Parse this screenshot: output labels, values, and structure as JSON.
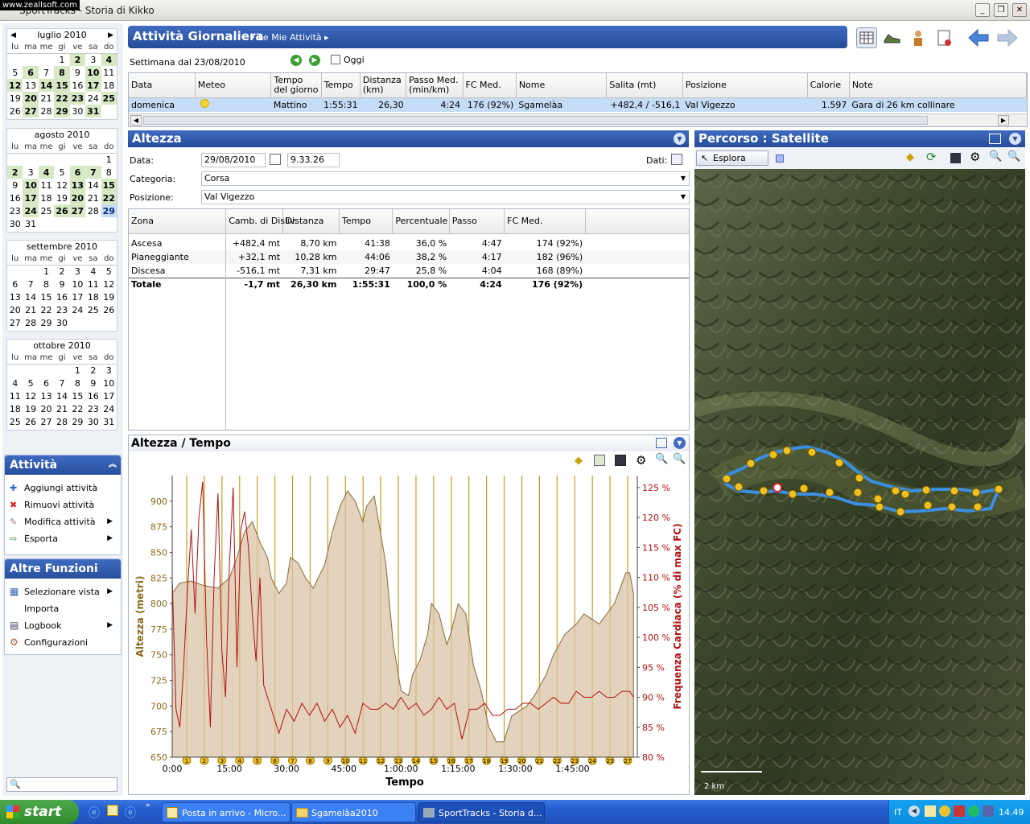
{
  "watermark": "www.zeallsoft.com",
  "window_title": "SportTracks - Storia di Kikko",
  "calendars": [
    {
      "month": "luglio 2010",
      "days": [
        "lu",
        "ma",
        "me",
        "gi",
        "ve",
        "sa",
        "do"
      ],
      "weeks": [
        [
          "",
          "",
          "",
          "1",
          "2",
          "3",
          "4"
        ],
        [
          "5",
          "6",
          "7",
          "8",
          "9",
          "10",
          "11"
        ],
        [
          "12",
          "13",
          "14",
          "15",
          "16",
          "17",
          "18"
        ],
        [
          "19",
          "20",
          "21",
          "22",
          "23",
          "24",
          "25"
        ],
        [
          "26",
          "27",
          "28",
          "29",
          "30",
          "31",
          ""
        ]
      ],
      "highlight": [
        "2",
        "4",
        "6",
        "8",
        "10",
        "12",
        "14",
        "15",
        "17",
        "20",
        "22",
        "23",
        "25",
        "27",
        "29",
        "31"
      ]
    },
    {
      "month": "agosto 2010",
      "days": [
        "lu",
        "ma",
        "me",
        "gi",
        "ve",
        "sa",
        "do"
      ],
      "weeks": [
        [
          "",
          "",
          "",
          "",
          "",
          "",
          "1"
        ],
        [
          "2",
          "3",
          "4",
          "5",
          "6",
          "7",
          "8"
        ],
        [
          "9",
          "10",
          "11",
          "12",
          "13",
          "14",
          "15"
        ],
        [
          "16",
          "17",
          "18",
          "19",
          "20",
          "21",
          "22"
        ],
        [
          "23",
          "24",
          "25",
          "26",
          "27",
          "28",
          "29"
        ],
        [
          "30",
          "31",
          "",
          "",
          "",
          "",
          ""
        ]
      ],
      "highlight": [
        "2",
        "4",
        "6",
        "7",
        "10",
        "13",
        "15",
        "17",
        "20",
        "22",
        "24",
        "26",
        "27"
      ],
      "selected": "29"
    },
    {
      "month": "settembre 2010",
      "days": [
        "lu",
        "ma",
        "me",
        "gi",
        "ve",
        "sa",
        "do"
      ],
      "weeks": [
        [
          "",
          "",
          "1",
          "2",
          "3",
          "4",
          "5"
        ],
        [
          "6",
          "7",
          "8",
          "9",
          "10",
          "11",
          "12"
        ],
        [
          "13",
          "14",
          "15",
          "16",
          "17",
          "18",
          "19"
        ],
        [
          "20",
          "21",
          "22",
          "23",
          "24",
          "25",
          "26"
        ],
        [
          "27",
          "28",
          "29",
          "30",
          "",
          "",
          ""
        ]
      ],
      "highlight": []
    },
    {
      "month": "ottobre 2010",
      "days": [
        "lu",
        "ma",
        "me",
        "gi",
        "ve",
        "sa",
        "do"
      ],
      "weeks": [
        [
          "",
          "",
          "",
          "",
          "1",
          "2",
          "3"
        ],
        [
          "4",
          "5",
          "6",
          "7",
          "8",
          "9",
          "10"
        ],
        [
          "11",
          "12",
          "13",
          "14",
          "15",
          "16",
          "17"
        ],
        [
          "18",
          "19",
          "20",
          "21",
          "22",
          "23",
          "24"
        ],
        [
          "25",
          "26",
          "27",
          "28",
          "29",
          "30",
          "31"
        ]
      ],
      "highlight": []
    }
  ],
  "left_panel": {
    "activities_title": "Attività Giornaliera",
    "activities_items": [
      "Aggiungi attività",
      "Rimuovi attività",
      "Modifica attività",
      "Esporta"
    ],
    "other_title": "Altre Funzioni",
    "other_items": [
      "Selezionare vista",
      "Importa",
      "Logbook",
      "Configurazioni"
    ]
  },
  "header": {
    "title": "Attività Giornaliera",
    "breadcrumb": "Le Mie Attività"
  },
  "week": {
    "label": "Settimana dal 23/08/2010",
    "today": "Oggi"
  },
  "activity_table": {
    "columns": [
      "Data",
      "Meteo",
      "Tempo del giorno",
      "Tempo",
      "Distanza (km)",
      "Passo Med. (min/km)",
      "FC Med.",
      "Nome",
      "Salita (mt)",
      "Posizione",
      "Calorie",
      "Note"
    ],
    "row": [
      "domenica",
      "",
      "Mattino",
      "1:55:31",
      "26,30",
      "4:24",
      "176 (92%)",
      "Sgamelàa",
      "+482,4 / -516,1",
      "Val Vigezzo",
      "1.597",
      "Gara di 26 km collinare"
    ]
  },
  "altezza": {
    "title": "Altezza",
    "data_label": "Data:",
    "date": "29/08/2010",
    "time": "9.33.26",
    "dati_label": "Dati:",
    "categoria_label": "Categoria:",
    "categoria": "Corsa",
    "posizione_label": "Posizione:",
    "posizione": "Val Vigezzo",
    "zone_columns": [
      "Zona",
      "Camb. di Disliv.",
      "Distanza",
      "Tempo",
      "Percentuale",
      "Passo",
      "FC Med."
    ],
    "zones": [
      [
        "Ascesa",
        "+482,4 mt",
        "8,70 km",
        "41:38",
        "36,0 %",
        "4:47",
        "174 (92%)"
      ],
      [
        "Pianeggiante",
        "+32,1 mt",
        "10,28 km",
        "44:06",
        "38,2 %",
        "4:17",
        "182 (96%)"
      ],
      [
        "Discesa",
        "-516,1 mt",
        "7,31 km",
        "29:47",
        "25,8 %",
        "4:04",
        "168 (89%)"
      ],
      [
        "Totale",
        "-1,7 mt",
        "26,30 km",
        "1:55:31",
        "100,0 %",
        "4:24",
        "176 (92%)"
      ]
    ]
  },
  "chart_title": "Altezza / Tempo",
  "chart_data": {
    "type": "area",
    "xlabel": "Tempo",
    "ylabel": "Altezza (metri)",
    "y2label": "Frequenza Cardiaca (% di max FC)",
    "x_ticks": [
      "0:00",
      "15:00",
      "30:00",
      "45:00",
      "1:00:00",
      "1:15:00",
      "1:30:00",
      "1:45:00"
    ],
    "y_ticks": [
      650,
      675,
      700,
      725,
      750,
      775,
      800,
      825,
      850,
      875,
      900
    ],
    "y2_ticks": [
      "80 %",
      "85 %",
      "90 %",
      "95 %",
      "100 %",
      "105 %",
      "110 %",
      "115 %",
      "120 %",
      "125 %"
    ],
    "ylim": [
      650,
      925
    ],
    "y2lim": [
      80,
      127
    ],
    "xlim_min": [
      0,
      122
    ],
    "series": [
      {
        "name": "Altezza (metri)",
        "color": "#c8a676",
        "x": [
          0,
          2,
          5,
          8,
          12,
          15,
          17,
          19,
          21,
          23,
          25,
          26,
          28,
          30,
          31,
          33,
          35,
          37,
          40,
          42,
          44,
          46,
          48,
          50,
          51,
          53,
          56,
          58,
          60,
          62,
          63,
          65,
          67,
          68,
          70,
          72,
          73,
          75,
          77,
          79,
          81,
          83,
          85,
          87,
          89,
          91,
          93,
          95,
          98,
          100,
          103,
          106,
          108,
          110,
          112,
          114,
          116,
          117,
          119,
          120,
          121
        ],
        "y": [
          810,
          820,
          822,
          818,
          815,
          825,
          845,
          870,
          880,
          860,
          845,
          825,
          810,
          820,
          845,
          840,
          825,
          815,
          838,
          870,
          895,
          910,
          900,
          880,
          895,
          905,
          840,
          760,
          715,
          710,
          730,
          745,
          770,
          800,
          790,
          760,
          770,
          800,
          790,
          740,
          715,
          680,
          665,
          665,
          690,
          695,
          700,
          710,
          730,
          750,
          770,
          780,
          790,
          785,
          780,
          790,
          800,
          810,
          830,
          830,
          810
        ]
      },
      {
        "name": "Frequenza Cardiaca (% di max FC)",
        "color": "#b31010",
        "x": [
          0,
          1,
          2,
          3,
          4,
          5,
          6,
          7,
          8,
          9,
          10,
          11,
          12,
          13,
          14,
          15,
          16,
          17,
          18,
          19,
          20,
          21,
          22,
          23,
          24,
          26,
          28,
          30,
          32,
          34,
          36,
          38,
          40,
          42,
          44,
          46,
          48,
          50,
          52,
          54,
          56,
          58,
          60,
          62,
          64,
          66,
          68,
          70,
          72,
          74,
          76,
          78,
          80,
          82,
          84,
          86,
          88,
          90,
          92,
          94,
          96,
          98,
          100,
          102,
          104,
          106,
          108,
          110,
          112,
          114,
          116,
          118,
          120,
          121
        ],
        "y": [
          110,
          88,
          85,
          95,
          108,
          118,
          104,
          120,
          126,
          100,
          85,
          110,
          124,
          98,
          90,
          112,
          125,
          95,
          118,
          121,
          115,
          104,
          96,
          110,
          92,
          88,
          84,
          88,
          86,
          89,
          87,
          89,
          86,
          88,
          85,
          87,
          84,
          89,
          88,
          88,
          89,
          88,
          90,
          88,
          89,
          87,
          88,
          90,
          88,
          89,
          83,
          88,
          88,
          89,
          87,
          87,
          88,
          88,
          89,
          89,
          88,
          89,
          90,
          89,
          89,
          91,
          90,
          90,
          91,
          90,
          90,
          91,
          91,
          90
        ]
      }
    ]
  },
  "chart_markers": [
    "1",
    "2",
    "3",
    "4",
    "5",
    "6",
    "7",
    "8",
    "9",
    "10",
    "11",
    "12",
    "13",
    "14",
    "15",
    "16",
    "17",
    "18",
    "19",
    "20",
    "21",
    "22",
    "23",
    "24",
    "25",
    "27"
  ],
  "map": {
    "title": "Percorso : Satellite",
    "explore": "Esplora",
    "scale": "2 km"
  },
  "taskbar": {
    "start": "start",
    "tasks": [
      "Posta in arrivo - Micro...",
      "Sgamelàa2010",
      "SportTracks - Storia d..."
    ],
    "lang": "IT",
    "clock": "14.49"
  }
}
